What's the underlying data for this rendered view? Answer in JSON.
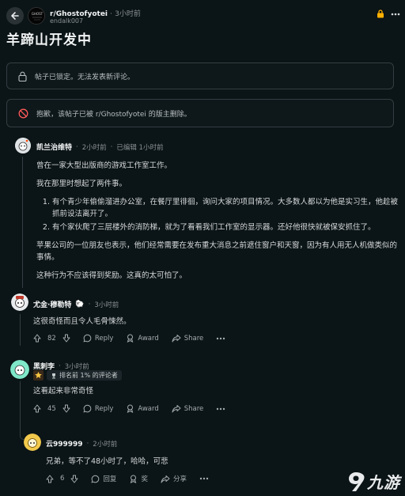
{
  "header": {
    "subreddit": "r/Ghostofyotei",
    "separator": "·",
    "post_time": "3小时前",
    "author": "endalk007",
    "subreddit_avatar_text": "GHOST"
  },
  "post": {
    "title": "羊蹄山开发中"
  },
  "notices": {
    "locked": "帖子已锁定。无法发表新评论。",
    "removed": "抱歉，该帖子已被 r/Ghostofyotei 的版主删除。"
  },
  "comments": [
    {
      "username": "凯兰治维特",
      "time": "2小时前",
      "edited": "已编辑 1小时前",
      "paragraphs": [
        "曾在一家大型出版商的游戏工作室工作。",
        "我在那里时想起了两件事。"
      ],
      "list": [
        "有个青少年偷偷溜进办公室，在餐厅里徘徊，询问大家的项目情况。大多数人都以为他是实习生，他趁被抓前设法离开了。",
        "有个家伙爬了三层楼外的消防梯，就为了看看我们工作室的显示器。还好他很快就被保安抓住了。"
      ],
      "paragraphs_after": [
        "苹果公司的一位朋友也表示，他们经常需要在发布重大消息之前遮住窗户和天窗，因为有人用无人机做类似的事情。",
        "这种行为不应该得到奖励。这真的太可怕了。"
      ]
    },
    {
      "username": "尤金·穆勒特",
      "flair_emoji": "🐑",
      "time": "3小时前",
      "body": "这很奇怪而且令人毛骨悚然。",
      "votes": "82",
      "reply": "Reply",
      "award": "Award",
      "share": "Share"
    },
    {
      "username": "黑刺李",
      "time": "3小时前",
      "flair": "排名前 1% 的评论者",
      "body": "这看起来非常奇怪",
      "votes": "45",
      "reply": "Reply",
      "award": "Award",
      "share": "Share"
    },
    {
      "username": "云999999",
      "time": "2小时前",
      "body": "兄弟，等不了48小时了，哈哈，可悲",
      "votes": "6",
      "reply": "回复",
      "award": "奖",
      "share": "分享"
    }
  ],
  "watermark": {
    "text": "九游"
  },
  "colors": {
    "background": "#0b1416",
    "accent": "#ffb000",
    "meta": "#8a9196"
  }
}
